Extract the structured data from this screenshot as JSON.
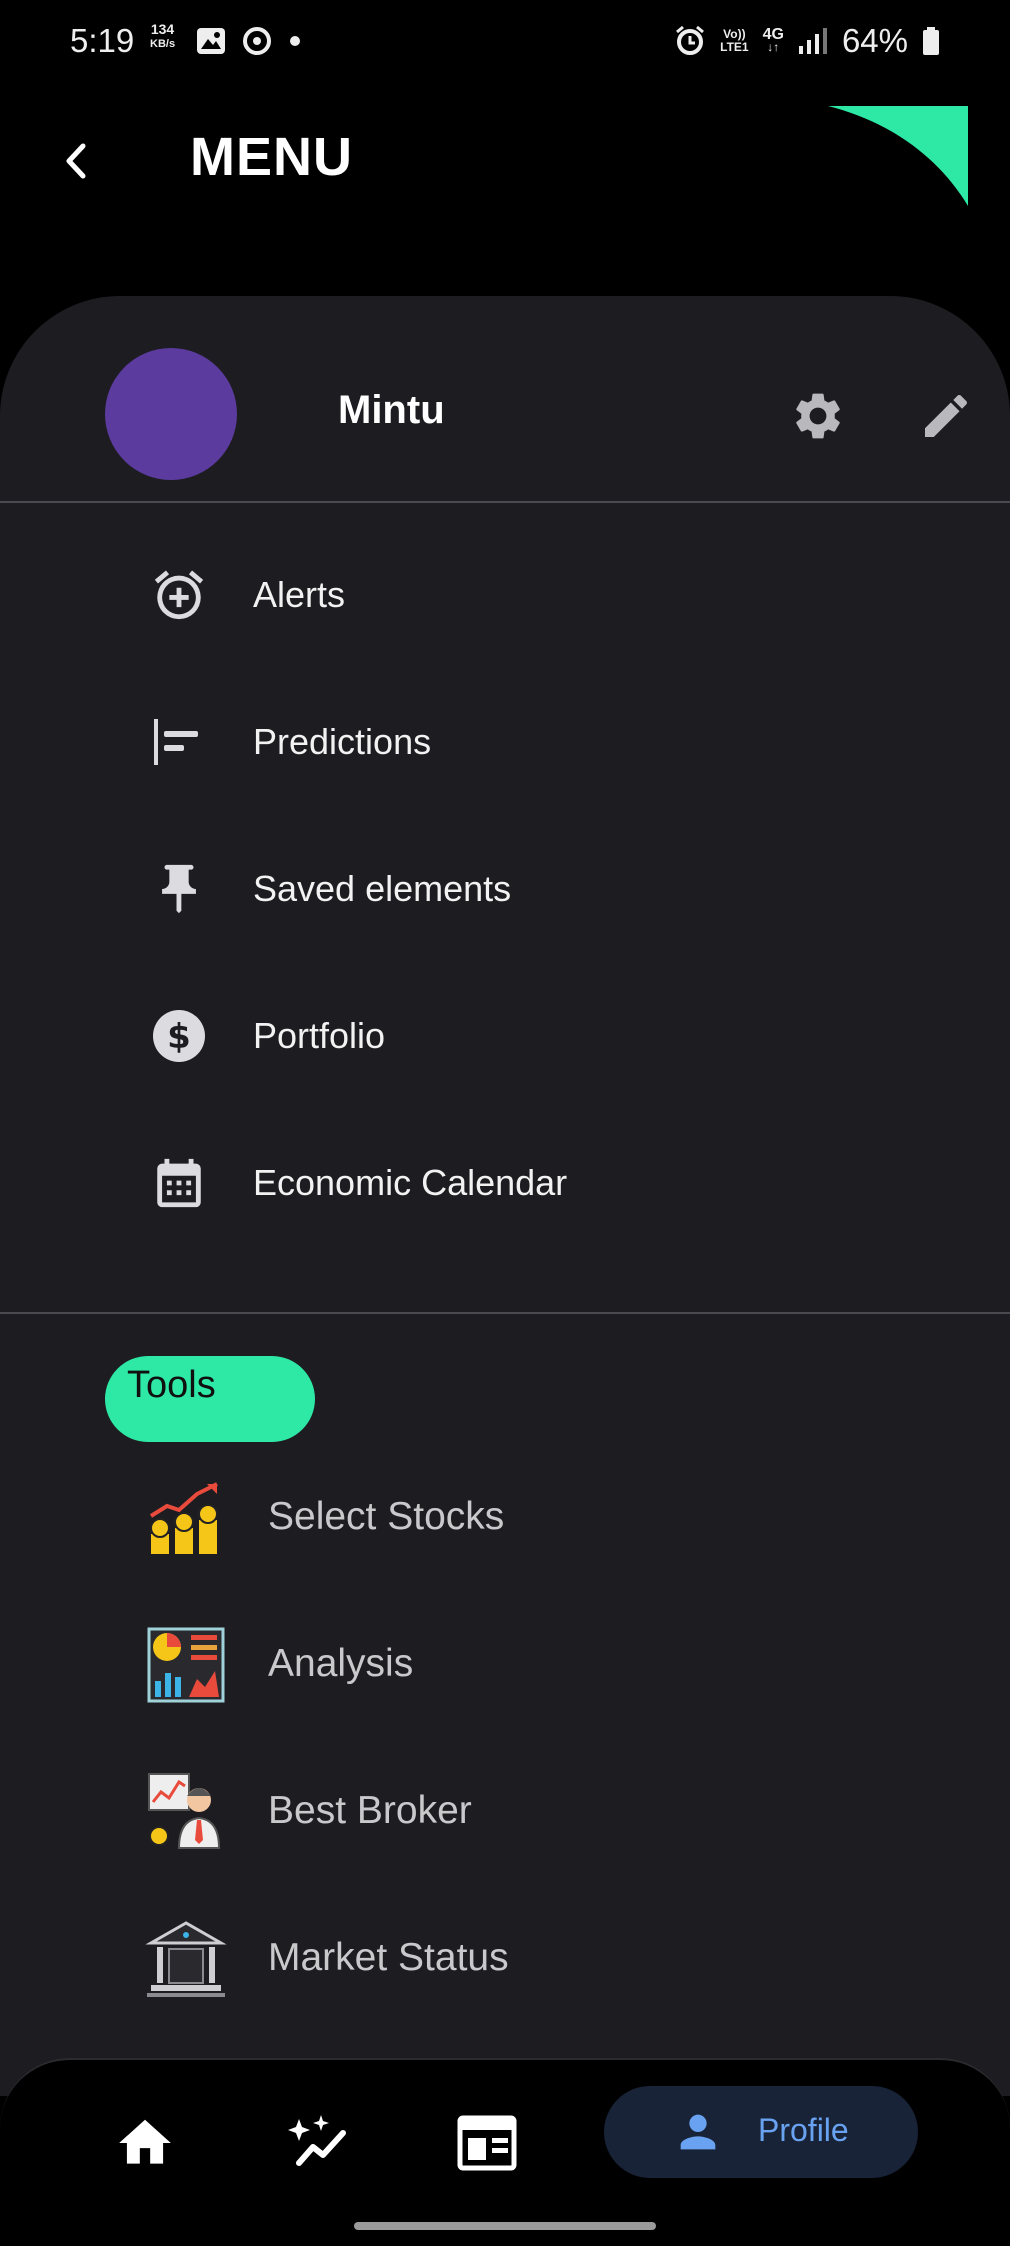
{
  "status_bar": {
    "time": "5:19",
    "speed_value": "134",
    "speed_unit": "KB/s",
    "volte_top": "Vo))",
    "volte_bottom": "LTE1",
    "network": "4G",
    "battery": "64%"
  },
  "header": {
    "title": "MENU"
  },
  "profile": {
    "name": "Mintu",
    "avatar_color": "#5b3b9e"
  },
  "menu": {
    "items": [
      {
        "label": "Alerts",
        "icon": "alarm-add-icon"
      },
      {
        "label": "Predictions",
        "icon": "align-left-icon"
      },
      {
        "label": "Saved elements",
        "icon": "pin-icon"
      },
      {
        "label": "Portfolio",
        "icon": "dollar-circle-icon"
      },
      {
        "label": "Economic Calendar",
        "icon": "calendar-icon"
      }
    ]
  },
  "tools": {
    "heading": "Tools",
    "items": [
      {
        "label": "Select Stocks",
        "icon": "stocks-growth-icon"
      },
      {
        "label": "Analysis",
        "icon": "analysis-charts-icon"
      },
      {
        "label": "Best Broker",
        "icon": "broker-icon"
      },
      {
        "label": "Market Status",
        "icon": "bank-building-icon"
      }
    ]
  },
  "bottom_nav": {
    "home_icon": "home-icon",
    "predict_icon": "sparkle-trend-icon",
    "news_icon": "newspaper-icon",
    "profile_label": "Profile"
  },
  "colors": {
    "accent": "#2ee8a6",
    "panel": "#1d1c21",
    "nav_active": "#182338",
    "nav_active_text": "#69a2f0"
  }
}
